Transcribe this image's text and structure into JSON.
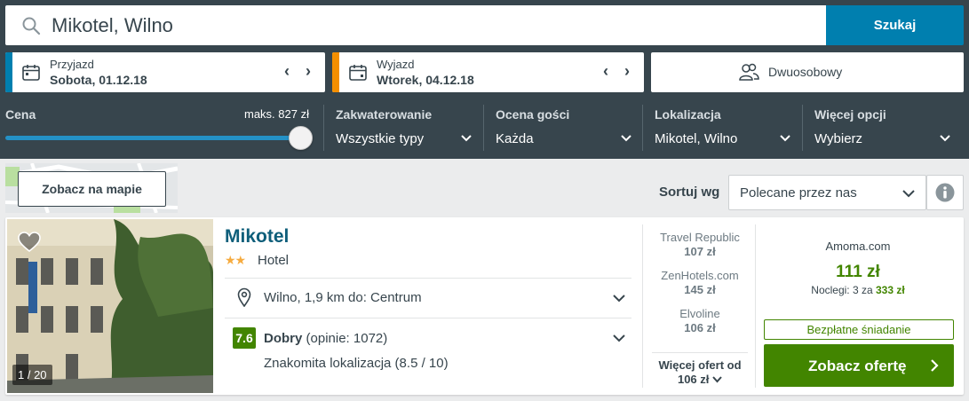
{
  "search": {
    "value": "Mikotel, Wilno",
    "button_label": "Szukaj"
  },
  "checkin": {
    "label": "Przyjazd",
    "value": "Sobota, 01.12.18",
    "accent": "#007faf"
  },
  "checkout": {
    "label": "Wyjazd",
    "value": "Wtorek, 04.12.18",
    "accent": "#f48f00"
  },
  "room": {
    "label": "Dwuosobowy"
  },
  "filters": {
    "price": {
      "label": "Cena",
      "max_label": "maks. 827 zł",
      "level_percent": 100
    },
    "accommodation": {
      "label": "Zakwaterowanie",
      "value": "Wszystkie typy"
    },
    "guest_rating": {
      "label": "Ocena gości",
      "value": "Każda"
    },
    "location": {
      "label": "Lokalizacja",
      "value": "Mikotel, Wilno"
    },
    "more": {
      "label": "Więcej opcji",
      "value": "Wybierz"
    }
  },
  "map": {
    "button_label": "Zobacz na mapie"
  },
  "sort": {
    "label": "Sortuj wg",
    "value": "Polecane przez nas"
  },
  "result": {
    "name": "Mikotel",
    "stars": "★★",
    "star_count": 2,
    "type": "Hotel",
    "photo_count": "1 / 20",
    "location": "Wilno, 1,9 km do: Centrum",
    "rating_score": "7.6",
    "rating_word": "Dobry",
    "rating_count": "(opinie: 1072)",
    "rating_sub": "Znakomita lokalizacja (8.5 / 10)",
    "deals": [
      {
        "provider": "Travel Republic",
        "price": "107 zł"
      },
      {
        "provider": "ZenHotels.com",
        "price": "145 zł"
      },
      {
        "provider": "Elvoline",
        "price": "106 zł"
      }
    ],
    "more_offers_label": "Więcej ofert od",
    "more_offers_price": "106 zł",
    "best_provider": "Amoma.com",
    "best_price": "111 zł",
    "nights_prefix": "Noclegi: 3 za",
    "nights_total": "333 zł",
    "breakfast": "Bezpłatne śniadanie",
    "cta_label": "Zobacz ofertę"
  },
  "colors": {
    "header_bg": "#37454d",
    "search_button": "#007faf",
    "deal_green": "#428500",
    "hotel_name": "#0e5e7a"
  }
}
